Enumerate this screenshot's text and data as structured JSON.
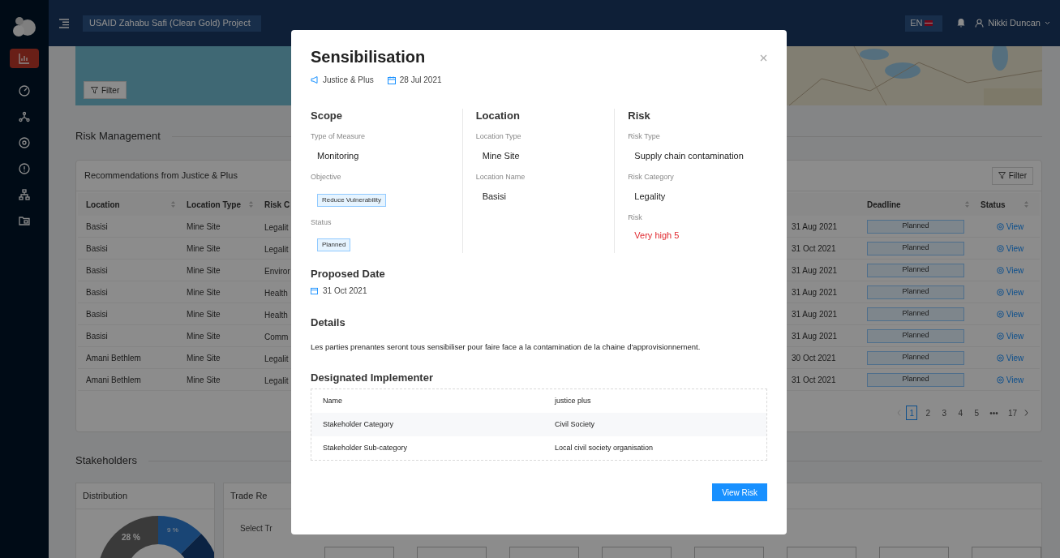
{
  "sidebar": {
    "items": [
      {
        "selected": true
      },
      {
        "selected": false
      },
      {
        "selected": false
      },
      {
        "selected": false
      },
      {
        "selected": false
      },
      {
        "selected": false
      },
      {
        "selected": false
      }
    ]
  },
  "header": {
    "project": "USAID Zahabu Safi (Clean Gold) Project",
    "language": "EN",
    "user": "Nikki Duncan"
  },
  "banner": {
    "filter_button": "Filter"
  },
  "risk_management": {
    "title": "Risk Management",
    "card": {
      "title": "Recommendations from Justice & Plus",
      "filter_button": "Filter",
      "columns": [
        "Location",
        "Location Type",
        "Risk C",
        "Deadline",
        "Status"
      ],
      "rows": [
        {
          "location": "Basisi",
          "location_type": "Mine Site",
          "column_3": "Legalit",
          "deadline": "31 Aug 2021",
          "status": "Planned",
          "action": "View"
        },
        {
          "location": "Basisi",
          "location_type": "Mine Site",
          "column_3": "Legalit",
          "deadline": "31 Oct 2021",
          "status": "Planned",
          "action": "View"
        },
        {
          "location": "Basisi",
          "location_type": "Mine Site",
          "column_3": "Enviror",
          "deadline": "31 Aug 2021",
          "status": "Planned",
          "action": "View"
        },
        {
          "location": "Basisi",
          "location_type": "Mine Site",
          "column_3": "Health",
          "deadline": "31 Aug 2021",
          "status": "Planned",
          "action": "View"
        },
        {
          "location": "Basisi",
          "location_type": "Mine Site",
          "column_3": "Health",
          "deadline": "31 Aug 2021",
          "status": "Planned",
          "action": "View"
        },
        {
          "location": "Basisi",
          "location_type": "Mine Site",
          "column_3": "Comm",
          "deadline": "31 Aug 2021",
          "status": "Planned",
          "action": "View"
        },
        {
          "location": "Amani Bethlem",
          "location_type": "Mine Site",
          "column_3": "Legalit",
          "deadline": "30 Oct 2021",
          "status": "Planned",
          "action": "View"
        },
        {
          "location": "Amani Bethlem",
          "location_type": "Mine Site",
          "column_3": "Legalit",
          "deadline": "31 Oct 2021",
          "status": "Planned",
          "action": "View"
        }
      ],
      "pagination": {
        "pages": [
          {
            "label": "1",
            "selected": true
          },
          {
            "label": "2",
            "selected": false
          },
          {
            "label": "3",
            "selected": false
          },
          {
            "label": "4",
            "selected": false
          },
          {
            "label": "5",
            "selected": false
          },
          {
            "label": "•••",
            "selected": false
          },
          {
            "label": "17",
            "selected": false
          }
        ]
      }
    }
  },
  "stakeholders": {
    "title": "Stakeholders",
    "distribution": {
      "title": "Distribution",
      "slice_labels": [
        "28 %",
        "9 %"
      ]
    },
    "trade": {
      "title": "Trade Re",
      "placeholder": "Select Tr"
    }
  },
  "modal": {
    "title": "Sensibilisation",
    "organisation": "Justice & Plus",
    "date": "28 Jul 2021",
    "columns": [
      {
        "heading": "Scope",
        "fields": [
          {
            "label": "Type of Measure",
            "value": "Monitoring",
            "kind": "text"
          },
          {
            "label": "Objective",
            "value": "Reduce Vulnerability",
            "kind": "tag"
          },
          {
            "label": "Status",
            "value": "Planned",
            "kind": "tag"
          }
        ]
      },
      {
        "heading": "Location",
        "fields": [
          {
            "label": "Location Type",
            "value": "Mine Site",
            "kind": "text"
          },
          {
            "label": "Location Name",
            "value": "Basisi",
            "kind": "text"
          }
        ]
      },
      {
        "heading": "Risk",
        "fields": [
          {
            "label": "Risk Type",
            "value": "Supply chain contamination",
            "kind": "text"
          },
          {
            "label": "Risk Category",
            "value": "Legality",
            "kind": "text"
          },
          {
            "label": "Risk",
            "value": "Very high 5",
            "kind": "alert"
          }
        ]
      }
    ],
    "proposed_date": {
      "heading": "Proposed Date",
      "date": "31 Oct 2021"
    },
    "details": {
      "heading": "Details",
      "text": "Les parties prenantes seront tous sensibiliser pour faire face a la contamination de la chaine d'approvisionnement."
    },
    "implementer": {
      "heading": "Designated Implementer",
      "rows": [
        {
          "label": "Name",
          "value": "justice plus"
        },
        {
          "label": "Stakeholder Category",
          "value": "Civil Society"
        },
        {
          "label": "Stakeholder Sub-category",
          "value": "Local civil society organisation"
        }
      ]
    },
    "button": "View Risk"
  }
}
